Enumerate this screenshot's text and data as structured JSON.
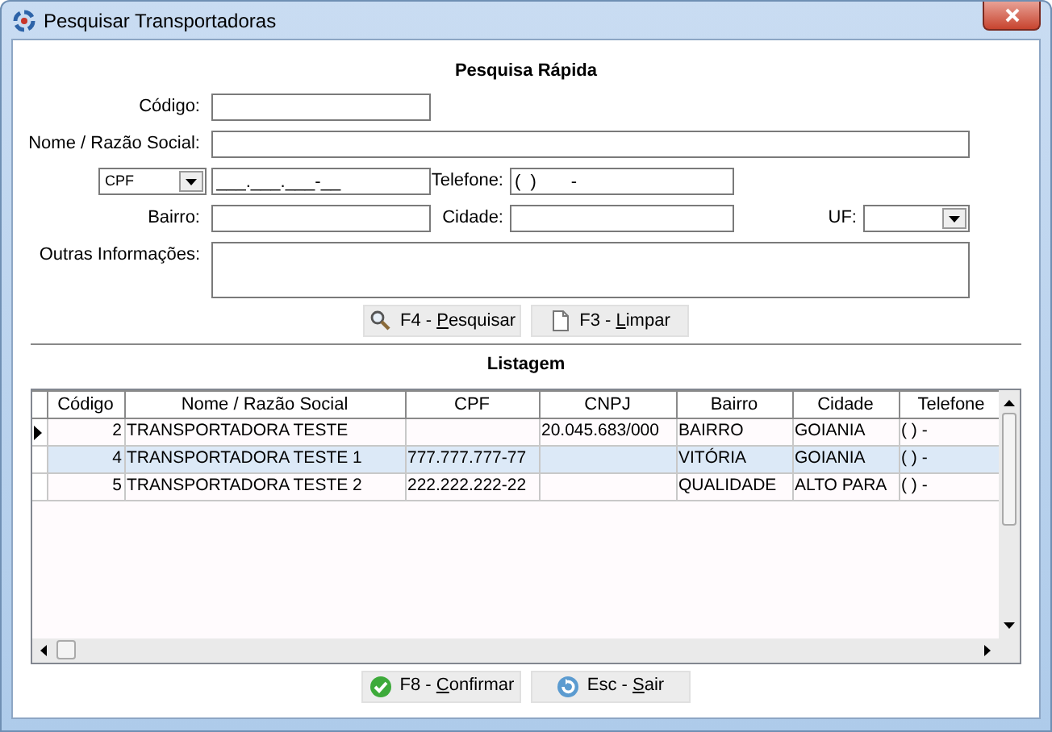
{
  "window": {
    "title": "Pesquisar Transportadoras"
  },
  "search": {
    "heading": "Pesquisa Rápida",
    "codigo": {
      "label": "Código:"
    },
    "nome": {
      "label": "Nome / Razão Social:"
    },
    "doc_type": {
      "value": "CPF"
    },
    "doc": {
      "value": "___.___.___-__"
    },
    "telefone": {
      "label": "Telefone:",
      "value": "(  )       -"
    },
    "bairro": {
      "label": "Bairro:"
    },
    "cidade": {
      "label": "Cidade:"
    },
    "uf": {
      "label": "UF:"
    },
    "outras": {
      "label": "Outras Informações:"
    },
    "buttons": [
      {
        "kind": "search",
        "prefix": "F4 - ",
        "mnemonic": "P",
        "rest": "esquisar"
      },
      {
        "kind": "clear",
        "prefix": "F3 - ",
        "mnemonic": "L",
        "rest": "impar"
      }
    ]
  },
  "listing": {
    "heading": "Listagem",
    "columns": [
      "Código",
      "Nome / Razão Social",
      "CPF",
      "CNPJ",
      "Bairro",
      "Cidade",
      "Telefone"
    ],
    "rows": [
      {
        "current": true,
        "selected": false,
        "cells": [
          "2",
          "TRANSPORTADORA TESTE",
          "",
          "20.045.683/000",
          "BAIRRO",
          "GOIANIA",
          "(  )     -"
        ]
      },
      {
        "current": false,
        "selected": true,
        "cells": [
          "4",
          "TRANSPORTADORA TESTE 1",
          "777.777.777-77",
          "",
          "VITÓRIA",
          "GOIANIA",
          "(  )     -"
        ]
      },
      {
        "current": false,
        "selected": false,
        "cells": [
          "5",
          "TRANSPORTADORA TESTE 2",
          "222.222.222-22",
          "",
          "QUALIDADE",
          "ALTO PARA",
          "(  )     -"
        ]
      }
    ]
  },
  "buttons": [
    {
      "kind": "confirm",
      "prefix": "F8 - ",
      "mnemonic": "C",
      "rest": "onfirmar"
    },
    {
      "kind": "exit",
      "prefix": "Esc - ",
      "mnemonic": "S",
      "rest": "air"
    }
  ]
}
